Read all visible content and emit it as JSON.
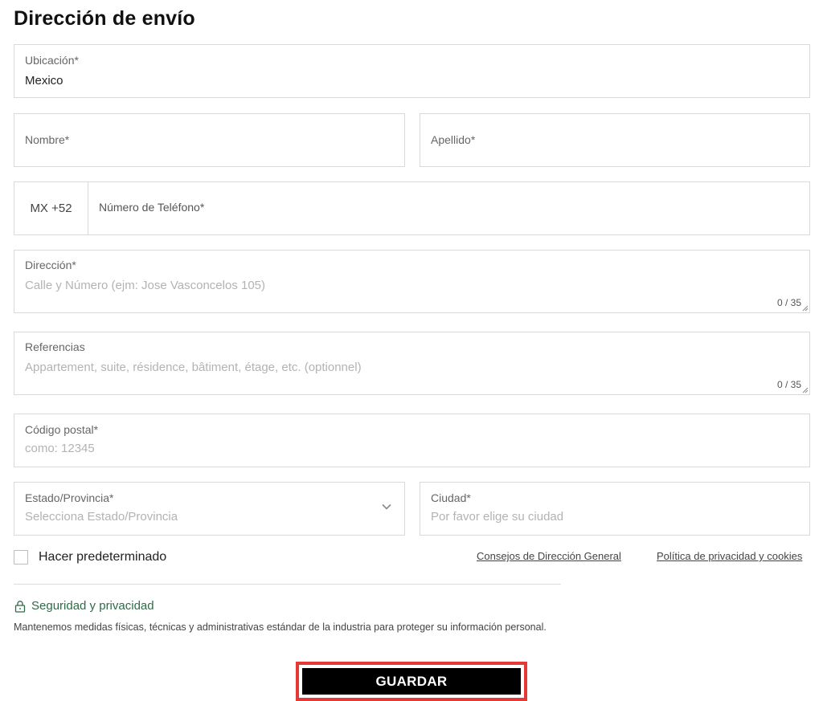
{
  "header": {
    "title": "Dirección de envío"
  },
  "fields": {
    "location": {
      "label": "Ubicación*",
      "value": "Mexico"
    },
    "first_name": {
      "label": "Nombre*"
    },
    "last_name": {
      "label": "Apellido*"
    },
    "phone": {
      "prefix": "MX +52",
      "label": "Número de Teléfono*"
    },
    "address": {
      "label": "Dirección*",
      "placeholder": "Calle y Número (ejm: Jose Vasconcelos 105)",
      "counter": "0 / 35"
    },
    "references": {
      "label": "Referencias",
      "placeholder": "Appartement, suite, résidence, bâtiment, étage, etc. (optionnel)",
      "counter": "0 / 35"
    },
    "postal_code": {
      "label": "Código postal*",
      "placeholder": "como: 12345"
    },
    "state": {
      "label": "Estado/Provincia*",
      "placeholder": "Selecciona Estado/Provincia"
    },
    "city": {
      "label": "Ciudad*",
      "placeholder": "Por favor elige su ciudad"
    }
  },
  "default_checkbox": {
    "label": "Hacer predeterminado",
    "checked": false
  },
  "links": {
    "address_tips": "Consejos de Dirección General",
    "privacy_policy": "Política de privacidad y cookies"
  },
  "security": {
    "title": "Seguridad y privacidad",
    "text": "Mantenemos medidas físicas, técnicas y administrativas estándar de la industria para proteger su información personal.",
    "icon": "lock-icon",
    "color": "#2e6b47"
  },
  "save_button": {
    "label": "GUARDAR",
    "highlight_color": "#e53935"
  }
}
